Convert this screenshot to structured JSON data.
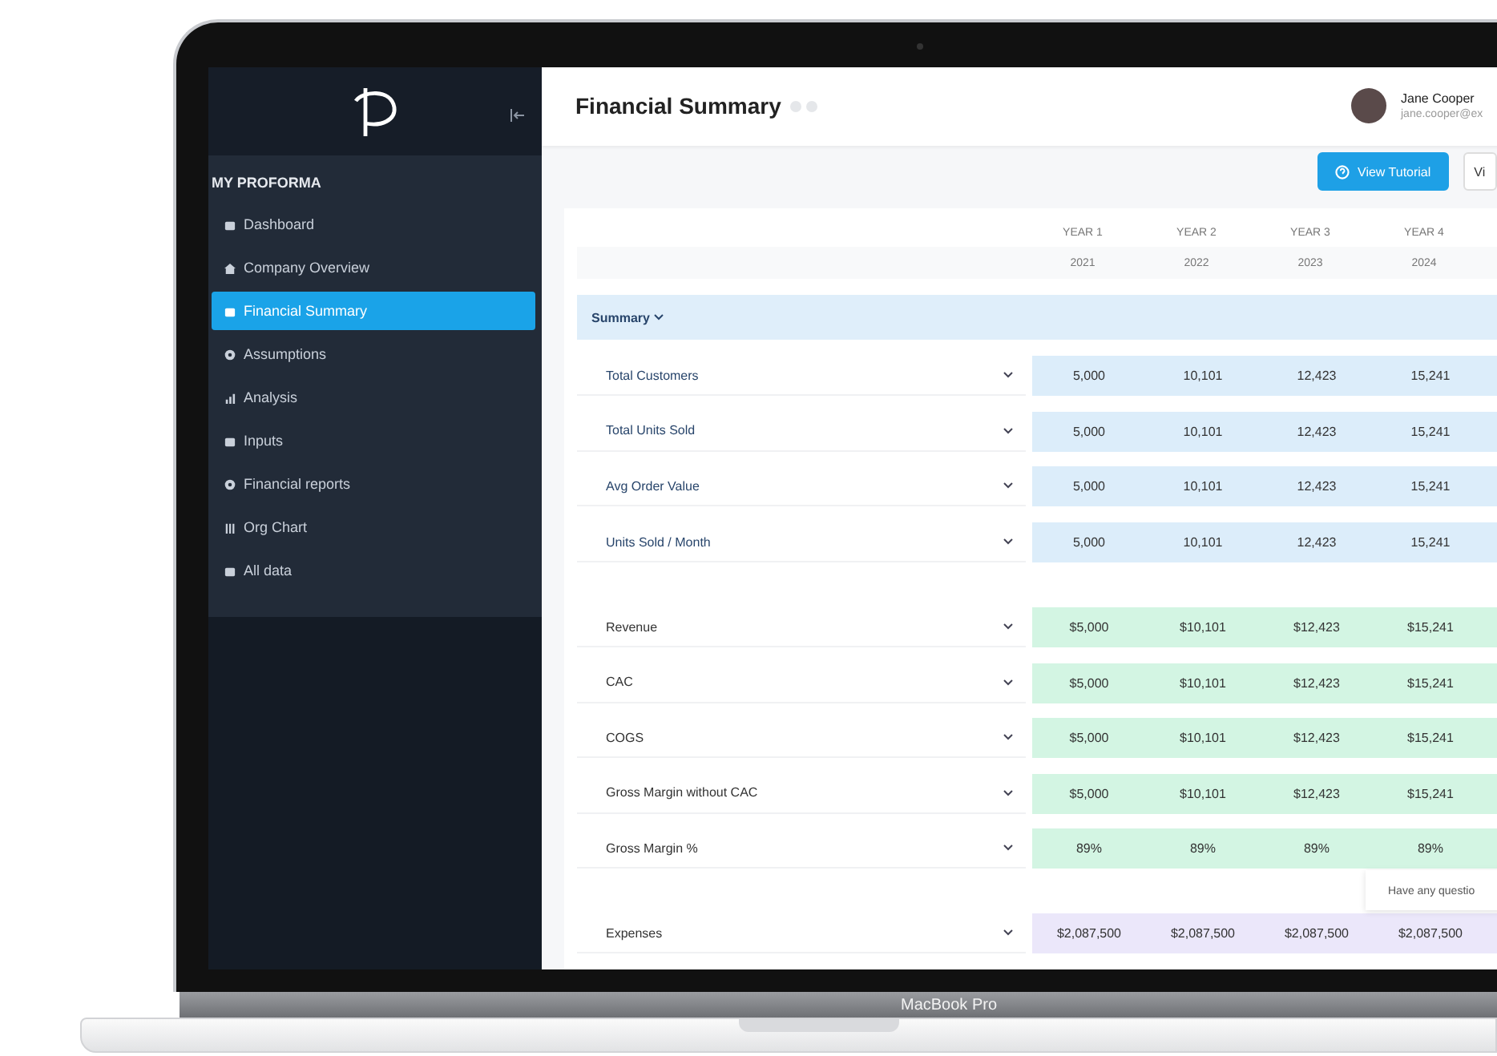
{
  "device": {
    "label": "MacBook Pro"
  },
  "sidebar": {
    "section": "MY PROFORMA",
    "items": [
      {
        "label": "Dashboard",
        "selected": false
      },
      {
        "label": "Company Overview",
        "selected": false
      },
      {
        "label": "Financial Summary",
        "selected": true
      },
      {
        "label": "Assumptions",
        "selected": false
      },
      {
        "label": "Analysis",
        "selected": false
      },
      {
        "label": "Inputs",
        "selected": false
      },
      {
        "label": "Financial reports",
        "selected": false
      },
      {
        "label": "Org Chart",
        "selected": false
      },
      {
        "label": "All data",
        "selected": false
      }
    ]
  },
  "header": {
    "title": "Financial Summary",
    "user": {
      "name": "Jane Cooper",
      "email": "jane.cooper@ex"
    }
  },
  "toolbar": {
    "buttons": [
      "View Tutorial",
      "Vi"
    ]
  },
  "table": {
    "columns": [
      {
        "label": "YEAR 1",
        "year": "2021"
      },
      {
        "label": "YEAR 2",
        "year": "2022"
      },
      {
        "label": "YEAR 3",
        "year": "2023"
      },
      {
        "label": "YEAR 4",
        "year": "2024"
      }
    ],
    "section": {
      "label": "Summary",
      "expanded": true
    },
    "groups": [
      {
        "color": "#dcedfa",
        "rows": [
          {
            "label": "Total Customers",
            "values": [
              "5,000",
              "10,101",
              "12,423",
              "15,241"
            ]
          },
          {
            "label": "Total Units Sold",
            "values": [
              "5,000",
              "10,101",
              "12,423",
              "15,241"
            ]
          },
          {
            "label": "Avg Order Value",
            "values": [
              "5,000",
              "10,101",
              "12,423",
              "15,241"
            ]
          },
          {
            "label": "Units Sold / Month",
            "values": [
              "5,000",
              "10,101",
              "12,423",
              "15,241"
            ]
          }
        ]
      },
      {
        "color": "#d3f5e3",
        "rows": [
          {
            "label": "Revenue",
            "values": [
              "$5,000",
              "$10,101",
              "$12,423",
              "$15,241"
            ]
          },
          {
            "label": "CAC",
            "values": [
              "$5,000",
              "$10,101",
              "$12,423",
              "$15,241"
            ]
          },
          {
            "label": "COGS",
            "values": [
              "$5,000",
              "$10,101",
              "$12,423",
              "$15,241"
            ]
          },
          {
            "label": "Gross Margin without CAC",
            "values": [
              "$5,000",
              "$10,101",
              "$12,423",
              "$15,241"
            ]
          },
          {
            "label": "Gross Margin %",
            "values": [
              "89%",
              "89%",
              "89%",
              "89%"
            ]
          }
        ]
      },
      {
        "color": "#ebe7fa",
        "rows": [
          {
            "label": "Expenses",
            "values": [
              "$2,087,500",
              "$2,087,500",
              "$2,087,500",
              "$2,087,500"
            ]
          }
        ]
      }
    ]
  },
  "chat_prompt": "Have any questio"
}
